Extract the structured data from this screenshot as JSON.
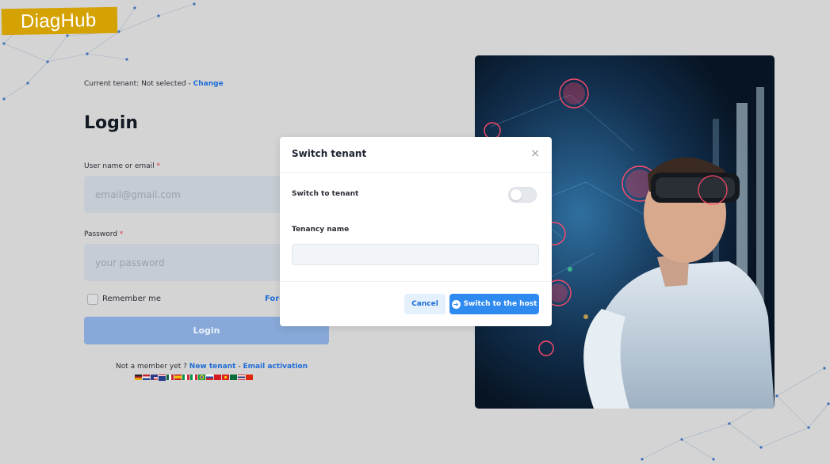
{
  "app": {
    "logo_text": "DiagHub",
    "brand_color": "#d5a204",
    "accent_color": "#2f8af0"
  },
  "tenant": {
    "label": "Current tenant: Not selected - ",
    "change_link": "Change"
  },
  "login": {
    "title": "Login",
    "username_label": "User name or email ",
    "username_placeholder": "email@gmail.com",
    "password_label": "Password ",
    "password_placeholder": "your password",
    "required_mark": "*",
    "remember_label": "Remember me",
    "forgot_label": "Forg",
    "button_label": "Login"
  },
  "footer": {
    "member_text": "Not a member yet ? ",
    "new_tenant_link": "New tenant",
    "separator": " - ",
    "email_activation_link": "Email activation",
    "language_flags": [
      "de",
      "nl",
      "us",
      "gb",
      "mx",
      "es",
      "it",
      "it-alt",
      "br",
      "ru",
      "tr",
      "vn",
      "sa",
      "th",
      "cn"
    ]
  },
  "modal": {
    "title": "Switch tenant",
    "close_icon": "×",
    "switch_label": "Switch to tenant",
    "switch_on": false,
    "tenancy_label": "Tenancy name",
    "tenancy_value": "",
    "cancel_label": "Cancel",
    "host_button_label": "Switch to the host",
    "host_icon": "➜"
  },
  "photo": {
    "icon": "vr-scientist-image"
  }
}
